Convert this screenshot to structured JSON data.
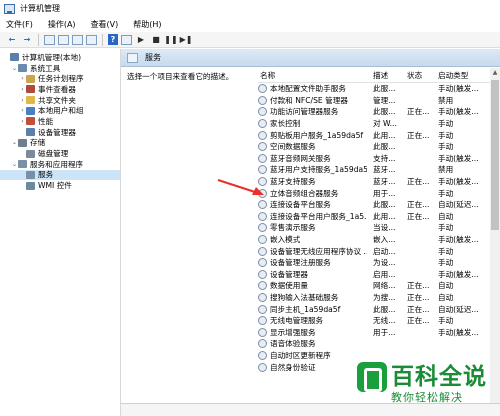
{
  "window": {
    "title": "计算机管理"
  },
  "menu": [
    "文件(F)",
    "操作(A)",
    "查看(V)",
    "帮助(H)"
  ],
  "tree": [
    {
      "label": "计算机管理(本地)",
      "indent": 0,
      "expander": "",
      "icon_color": "#5b7fa8"
    },
    {
      "label": "系统工具",
      "indent": 1,
      "expander": "⌄",
      "icon_color": "#6a8bb0"
    },
    {
      "label": "任务计划程序",
      "indent": 2,
      "expander": "›",
      "icon_color": "#c9a64d"
    },
    {
      "label": "事件查看器",
      "indent": 2,
      "expander": "›",
      "icon_color": "#b04a3a"
    },
    {
      "label": "共享文件夹",
      "indent": 2,
      "expander": "›",
      "icon_color": "#e0b84a"
    },
    {
      "label": "本地用户和组",
      "indent": 2,
      "expander": "›",
      "icon_color": "#4a7fc0"
    },
    {
      "label": "性能",
      "indent": 2,
      "expander": "›",
      "icon_color": "#c0503a"
    },
    {
      "label": "设备管理器",
      "indent": 2,
      "expander": "",
      "icon_color": "#5a80b0"
    },
    {
      "label": "存储",
      "indent": 1,
      "expander": "⌄",
      "icon_color": "#6f7f90"
    },
    {
      "label": "磁盘管理",
      "indent": 2,
      "expander": "",
      "icon_color": "#7a8a9a"
    },
    {
      "label": "服务和应用程序",
      "indent": 1,
      "expander": "⌄",
      "icon_color": "#7a8fa8"
    },
    {
      "label": "服务",
      "indent": 2,
      "expander": "",
      "icon_color": "#7a8fa8",
      "selected": true
    },
    {
      "label": "WMI 控件",
      "indent": 2,
      "expander": "",
      "icon_color": "#6a8aa0"
    }
  ],
  "panel": {
    "header": "服务",
    "description": "选择一个项目来查看它的描述。"
  },
  "table": {
    "columns": [
      "名称",
      "描述",
      "状态",
      "启动类型"
    ],
    "rows": [
      {
        "name": "本地配置文件助手服务",
        "desc": "此服...",
        "status": "",
        "start": "手动(触发..."
      },
      {
        "name": "付款和 NFC/SE 管理器",
        "desc": "管理...",
        "status": "",
        "start": "禁用"
      },
      {
        "name": "功能访问管理器服务",
        "desc": "此服...",
        "status": "正在...",
        "start": "手动(触发..."
      },
      {
        "name": "家长控制",
        "desc": "对 W...",
        "status": "",
        "start": "手动"
      },
      {
        "name": "剪贴板用户服务_1a59da5f",
        "desc": "此用...",
        "status": "正在...",
        "start": "手动"
      },
      {
        "name": "空间数据服务",
        "desc": "此服...",
        "status": "",
        "start": "手动"
      },
      {
        "name": "蓝牙音频网关服务",
        "desc": "支持...",
        "status": "",
        "start": "手动(触发..."
      },
      {
        "name": "蓝牙用户支持服务_1a59da5f",
        "desc": "蓝牙...",
        "status": "",
        "start": "禁用"
      },
      {
        "name": "蓝牙支持服务",
        "desc": "蓝牙...",
        "status": "正在...",
        "start": "手动(触发..."
      },
      {
        "name": "立体音频组合器服务",
        "desc": "用于...",
        "status": "",
        "start": "手动"
      },
      {
        "name": "连接设备平台服务",
        "desc": "此服...",
        "status": "正在...",
        "start": "自动(延迟..."
      },
      {
        "name": "连接设备平台用户服务_1a5...",
        "desc": "此用...",
        "status": "正在...",
        "start": "自动"
      },
      {
        "name": "零售演示服务",
        "desc": "当设...",
        "status": "",
        "start": "手动"
      },
      {
        "name": "嵌入模式",
        "desc": "嵌入...",
        "status": "",
        "start": "手动(触发..."
      },
      {
        "name": "设备管理无线应用程序协议 ...",
        "desc": "启动...",
        "status": "",
        "start": "手动"
      },
      {
        "name": "设备管理注册服务",
        "desc": "为设...",
        "status": "",
        "start": "手动"
      },
      {
        "name": "设备管理器",
        "desc": "启用...",
        "status": "",
        "start": "手动(触发..."
      },
      {
        "name": "数据使用量",
        "desc": "网络...",
        "status": "正在...",
        "start": "自动"
      },
      {
        "name": "搜狗输入法基础服务",
        "desc": "为搜...",
        "status": "正在...",
        "start": "自动"
      },
      {
        "name": "同步主机_1a59da5f",
        "desc": "此服...",
        "status": "正在...",
        "start": "自动(延迟..."
      },
      {
        "name": "无线电管理服务",
        "desc": "无线...",
        "status": "正在...",
        "start": "手动"
      },
      {
        "name": "显示增强服务",
        "desc": "用于...",
        "status": "",
        "start": "手动(触发..."
      },
      {
        "name": "语音体验服务",
        "desc": "",
        "status": "",
        "start": ""
      },
      {
        "name": "自动时区更新程序",
        "desc": "",
        "status": "",
        "start": ""
      },
      {
        "name": "自然身份验证",
        "desc": "",
        "status": "",
        "start": ""
      }
    ]
  },
  "annotation": {
    "arrow_color": "#e8322a"
  },
  "watermark": {
    "title": "百科全说",
    "subtitle": "教你轻松解决",
    "color": "#1a8c36"
  }
}
